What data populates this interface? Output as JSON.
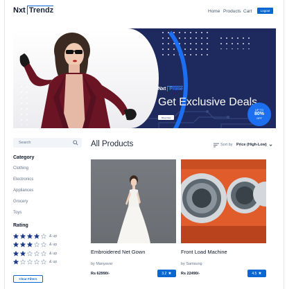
{
  "navbar": {
    "logo_part1": "Nxt",
    "logo_part2": "Trendz",
    "links": [
      "Home",
      "Products",
      "Cart"
    ],
    "logout_label": "Logout"
  },
  "banner": {
    "prime_logo_part1": "Nxt",
    "prime_logo_part2": "Prime",
    "heading": "Get Exclusive Deals",
    "button_label": "Shop Now",
    "offer_line1": "UP TO",
    "offer_percent": "80%",
    "offer_line2": "OFF"
  },
  "filters": {
    "search_placeholder": "Search",
    "category_heading": "Category",
    "categories": [
      "Clothing",
      "Electronics",
      "Appliances",
      "Grocery",
      "Toys"
    ],
    "rating_heading": "Rating",
    "ratings": [
      {
        "stars": 4,
        "label": "& up"
      },
      {
        "stars": 3,
        "label": "& up"
      },
      {
        "stars": 2,
        "label": "& up"
      },
      {
        "stars": 1,
        "label": "& up"
      }
    ],
    "clear_label": "Clear Filters"
  },
  "products_section": {
    "heading": "All Products",
    "sort_label": "Sort by",
    "sort_value": "Price (High-Low)"
  },
  "products": [
    {
      "title": "Embroidered Net Gown",
      "brand": "by Manyavar",
      "price": "Rs 62990/-",
      "rating": "3.2"
    },
    {
      "title": "Front Load Machine",
      "brand": "by Samsung",
      "price": "Rs 22490/-",
      "rating": "4.5"
    }
  ],
  "colors": {
    "primary": "#0967d2",
    "banner_bg": "#1e2a5e",
    "star_filled": "#1e3a8a",
    "washer_orange": "#e05c2a"
  }
}
